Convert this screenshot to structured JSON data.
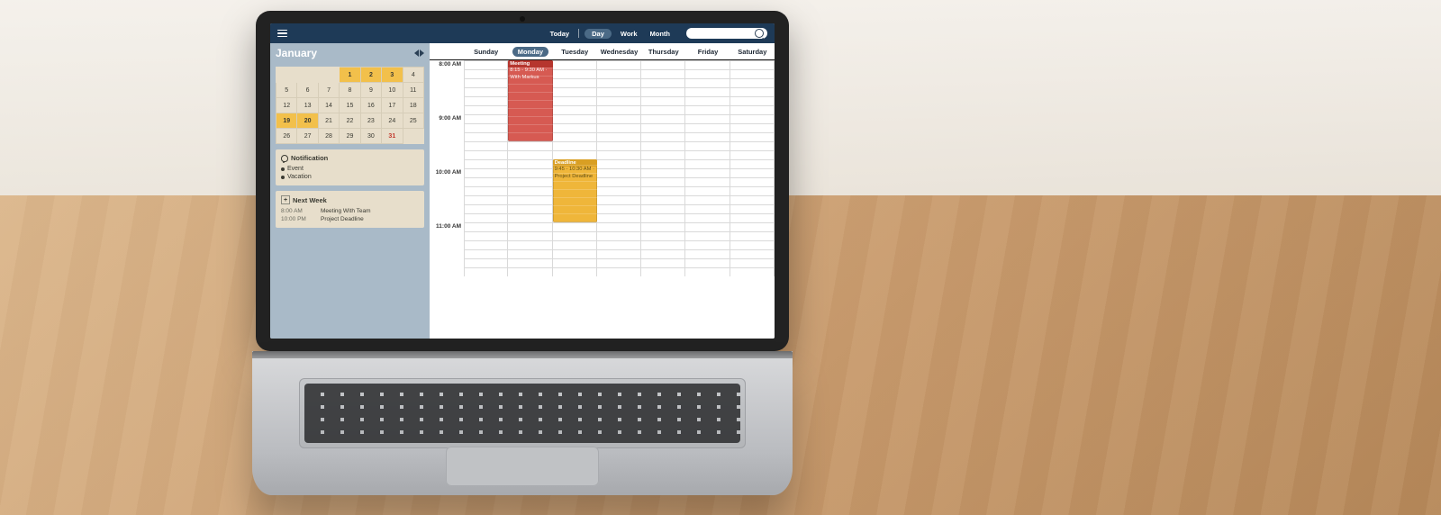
{
  "topbar": {
    "today": "Today",
    "views": [
      "Day",
      "Work",
      "Month"
    ],
    "active_view": 0,
    "search_placeholder": ""
  },
  "sidebar": {
    "month": "January",
    "calendar": {
      "rows": [
        [
          "",
          "",
          "",
          "1",
          "2",
          "3",
          "4"
        ],
        [
          "5",
          "6",
          "7",
          "8",
          "9",
          "10",
          "11"
        ],
        [
          "12",
          "13",
          "14",
          "15",
          "16",
          "17",
          "18"
        ],
        [
          "19",
          "20",
          "21",
          "22",
          "23",
          "24",
          "25"
        ],
        [
          "26",
          "27",
          "28",
          "29",
          "30",
          "31",
          ""
        ]
      ],
      "highlight": [
        "1",
        "2",
        "3",
        "19",
        "20"
      ],
      "red": [
        "31"
      ]
    },
    "notification": {
      "title": "Notification",
      "items": [
        "Event",
        "Vacation"
      ]
    },
    "next_week": {
      "title": "Next Week",
      "rows": [
        {
          "time": "8:00 AM",
          "text": "Meeting With Team"
        },
        {
          "time": "10:00 PM",
          "text": "Project Deadline"
        }
      ]
    }
  },
  "weekbar": {
    "days": [
      "Sunday",
      "Monday",
      "Tuesday",
      "Wednesday",
      "Thursday",
      "Friday",
      "Saturday"
    ],
    "current": 1
  },
  "timeline": {
    "labels": [
      "8:00 AM",
      "9:00 AM",
      "10:00 AM",
      "11:00 AM"
    ],
    "slots_per_hour": 6
  },
  "events": [
    {
      "id": "ev-meeting",
      "title": "Meeting",
      "sub": "8:15 - 9:30 AM · With Markus",
      "color": "red",
      "day": 1,
      "start": 0,
      "span": 9
    },
    {
      "id": "ev-deadline",
      "title": "Deadline",
      "sub": "9:45 - 10:30 AM · Project Deadline",
      "color": "yel",
      "day": 2,
      "start": 11,
      "span": 7
    }
  ]
}
